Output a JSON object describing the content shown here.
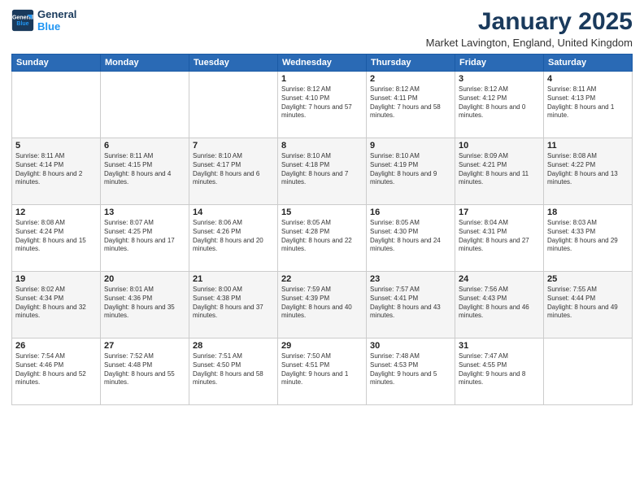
{
  "logo": {
    "line1": "General",
    "line2": "Blue"
  },
  "title": "January 2025",
  "location": "Market Lavington, England, United Kingdom",
  "weekdays": [
    "Sunday",
    "Monday",
    "Tuesday",
    "Wednesday",
    "Thursday",
    "Friday",
    "Saturday"
  ],
  "weeks": [
    [
      {
        "day": "",
        "info": ""
      },
      {
        "day": "",
        "info": ""
      },
      {
        "day": "",
        "info": ""
      },
      {
        "day": "1",
        "info": "Sunrise: 8:12 AM\nSunset: 4:10 PM\nDaylight: 7 hours and 57 minutes."
      },
      {
        "day": "2",
        "info": "Sunrise: 8:12 AM\nSunset: 4:11 PM\nDaylight: 7 hours and 58 minutes."
      },
      {
        "day": "3",
        "info": "Sunrise: 8:12 AM\nSunset: 4:12 PM\nDaylight: 8 hours and 0 minutes."
      },
      {
        "day": "4",
        "info": "Sunrise: 8:11 AM\nSunset: 4:13 PM\nDaylight: 8 hours and 1 minute."
      }
    ],
    [
      {
        "day": "5",
        "info": "Sunrise: 8:11 AM\nSunset: 4:14 PM\nDaylight: 8 hours and 2 minutes."
      },
      {
        "day": "6",
        "info": "Sunrise: 8:11 AM\nSunset: 4:15 PM\nDaylight: 8 hours and 4 minutes."
      },
      {
        "day": "7",
        "info": "Sunrise: 8:10 AM\nSunset: 4:17 PM\nDaylight: 8 hours and 6 minutes."
      },
      {
        "day": "8",
        "info": "Sunrise: 8:10 AM\nSunset: 4:18 PM\nDaylight: 8 hours and 7 minutes."
      },
      {
        "day": "9",
        "info": "Sunrise: 8:10 AM\nSunset: 4:19 PM\nDaylight: 8 hours and 9 minutes."
      },
      {
        "day": "10",
        "info": "Sunrise: 8:09 AM\nSunset: 4:21 PM\nDaylight: 8 hours and 11 minutes."
      },
      {
        "day": "11",
        "info": "Sunrise: 8:08 AM\nSunset: 4:22 PM\nDaylight: 8 hours and 13 minutes."
      }
    ],
    [
      {
        "day": "12",
        "info": "Sunrise: 8:08 AM\nSunset: 4:24 PM\nDaylight: 8 hours and 15 minutes."
      },
      {
        "day": "13",
        "info": "Sunrise: 8:07 AM\nSunset: 4:25 PM\nDaylight: 8 hours and 17 minutes."
      },
      {
        "day": "14",
        "info": "Sunrise: 8:06 AM\nSunset: 4:26 PM\nDaylight: 8 hours and 20 minutes."
      },
      {
        "day": "15",
        "info": "Sunrise: 8:05 AM\nSunset: 4:28 PM\nDaylight: 8 hours and 22 minutes."
      },
      {
        "day": "16",
        "info": "Sunrise: 8:05 AM\nSunset: 4:30 PM\nDaylight: 8 hours and 24 minutes."
      },
      {
        "day": "17",
        "info": "Sunrise: 8:04 AM\nSunset: 4:31 PM\nDaylight: 8 hours and 27 minutes."
      },
      {
        "day": "18",
        "info": "Sunrise: 8:03 AM\nSunset: 4:33 PM\nDaylight: 8 hours and 29 minutes."
      }
    ],
    [
      {
        "day": "19",
        "info": "Sunrise: 8:02 AM\nSunset: 4:34 PM\nDaylight: 8 hours and 32 minutes."
      },
      {
        "day": "20",
        "info": "Sunrise: 8:01 AM\nSunset: 4:36 PM\nDaylight: 8 hours and 35 minutes."
      },
      {
        "day": "21",
        "info": "Sunrise: 8:00 AM\nSunset: 4:38 PM\nDaylight: 8 hours and 37 minutes."
      },
      {
        "day": "22",
        "info": "Sunrise: 7:59 AM\nSunset: 4:39 PM\nDaylight: 8 hours and 40 minutes."
      },
      {
        "day": "23",
        "info": "Sunrise: 7:57 AM\nSunset: 4:41 PM\nDaylight: 8 hours and 43 minutes."
      },
      {
        "day": "24",
        "info": "Sunrise: 7:56 AM\nSunset: 4:43 PM\nDaylight: 8 hours and 46 minutes."
      },
      {
        "day": "25",
        "info": "Sunrise: 7:55 AM\nSunset: 4:44 PM\nDaylight: 8 hours and 49 minutes."
      }
    ],
    [
      {
        "day": "26",
        "info": "Sunrise: 7:54 AM\nSunset: 4:46 PM\nDaylight: 8 hours and 52 minutes."
      },
      {
        "day": "27",
        "info": "Sunrise: 7:52 AM\nSunset: 4:48 PM\nDaylight: 8 hours and 55 minutes."
      },
      {
        "day": "28",
        "info": "Sunrise: 7:51 AM\nSunset: 4:50 PM\nDaylight: 8 hours and 58 minutes."
      },
      {
        "day": "29",
        "info": "Sunrise: 7:50 AM\nSunset: 4:51 PM\nDaylight: 9 hours and 1 minute."
      },
      {
        "day": "30",
        "info": "Sunrise: 7:48 AM\nSunset: 4:53 PM\nDaylight: 9 hours and 5 minutes."
      },
      {
        "day": "31",
        "info": "Sunrise: 7:47 AM\nSunset: 4:55 PM\nDaylight: 9 hours and 8 minutes."
      },
      {
        "day": "",
        "info": ""
      }
    ]
  ]
}
